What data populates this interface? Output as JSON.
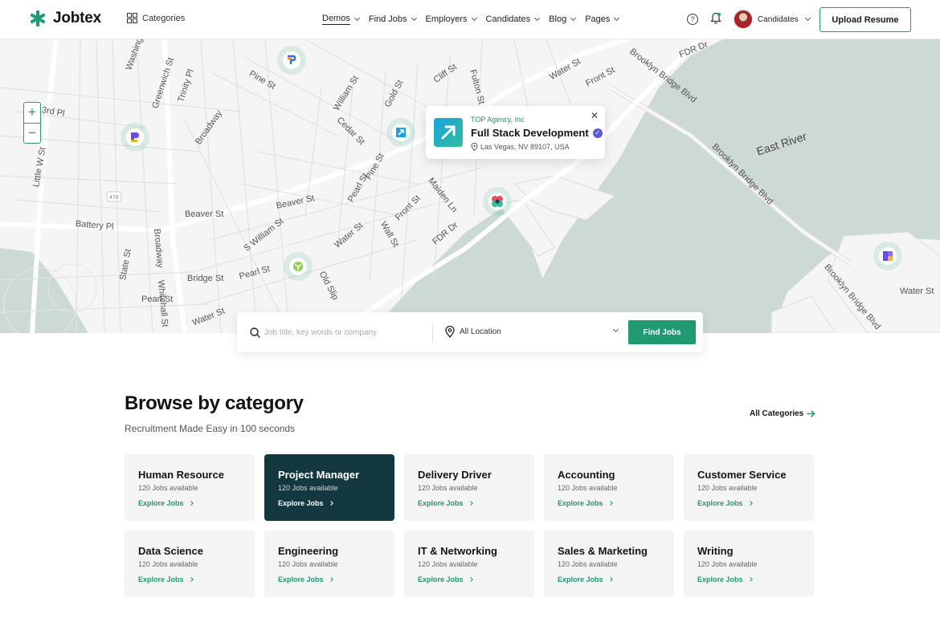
{
  "header": {
    "logo_text": "Jobtex",
    "categories_label": "Categories",
    "nav": [
      {
        "label": "Demos"
      },
      {
        "label": "Find Jobs"
      },
      {
        "label": "Employers"
      },
      {
        "label": "Candidates"
      },
      {
        "label": "Blog"
      },
      {
        "label": "Pages"
      }
    ],
    "user_label": "Candidates",
    "upload_label": "Upload Resume"
  },
  "map": {
    "labels": {
      "washington": "Washington St",
      "greenwich": "Greenwich St",
      "trinity": "Trinity Pl",
      "broadway": "Broadway",
      "pine": "Pine St",
      "william": "William St",
      "cedar": "Cedar St",
      "gold": "Gold St",
      "cliff": "Cliff St",
      "fulton": "Fulton St",
      "water_top": "Water St",
      "front": "Front St",
      "brooklyn_bridge_blvd": "Brooklyn Bridge Blvd",
      "fdr_top": "FDR Dr",
      "third": "3rd Pl",
      "little_west": "Little W St",
      "battery": "Battery Pl",
      "beaver_left": "Beaver St",
      "beaver_mid": "Beaver St",
      "s_william": "S William St",
      "pearl_mid": "Pearl St",
      "water_mid": "Water St",
      "wall": "Wall St",
      "front_mid": "Front St",
      "maiden": "Maiden Ln",
      "fdr_mid": "FDR Dr",
      "broadway_low": "Broadway",
      "whitehall": "Whitehall St",
      "bridge": "Bridge St",
      "state": "State St",
      "pearl_low": "Pearl St",
      "pearl_low2": "Pearl St",
      "old_slip": "Old Slip",
      "water_low": "Water St",
      "east_river": "East River",
      "brooklyn_bridge_blvd_2": "Brooklyn Bridge Blvd",
      "brooklyn_bridge_blvd_3": "Brooklyn Bridge Blvd",
      "water_right": "Water St",
      "highway_shield": "478"
    },
    "zoom_in": "+",
    "zoom_out": "−",
    "popup": {
      "company": "TOP Agency, Inc",
      "title": "Full Stack Development",
      "location": "Las Vegas, NV 89107, USA",
      "close": "✕"
    }
  },
  "search": {
    "placeholder": "Job title, key words or company",
    "location_value": "All Location",
    "button_label": "Find Jobs"
  },
  "browse": {
    "title": "Browse by category",
    "subtitle": "Recruitment Made Easy in 100 seconds",
    "all_label": "All Categories",
    "categories": [
      {
        "name": "Human Resource",
        "count": "120 Jobs available",
        "link": "Explore Jobs"
      },
      {
        "name": "Project Manager",
        "count": "120 Jobs available",
        "link": "Explore Jobs"
      },
      {
        "name": "Delivery Driver",
        "count": "120 Jobs available",
        "link": "Explore Jobs"
      },
      {
        "name": "Accounting",
        "count": "120 Jobs available",
        "link": "Explore Jobs"
      },
      {
        "name": "Customer Service",
        "count": "120 Jobs available",
        "link": "Explore Jobs"
      },
      {
        "name": "Data Science",
        "count": "120 Jobs available",
        "link": "Explore Jobs"
      },
      {
        "name": "Engineering",
        "count": "120 Jobs available",
        "link": "Explore Jobs"
      },
      {
        "name": "IT & Networking",
        "count": "120 Jobs available",
        "link": "Explore Jobs"
      },
      {
        "name": "Sales & Marketing",
        "count": "120 Jobs available",
        "link": "Explore Jobs"
      },
      {
        "name": "Writing",
        "count": "120 Jobs available",
        "link": "Explore Jobs"
      }
    ]
  },
  "colors": {
    "accent": "#1f9a72",
    "active_card": "#133840",
    "water": "#cdd9d5"
  }
}
